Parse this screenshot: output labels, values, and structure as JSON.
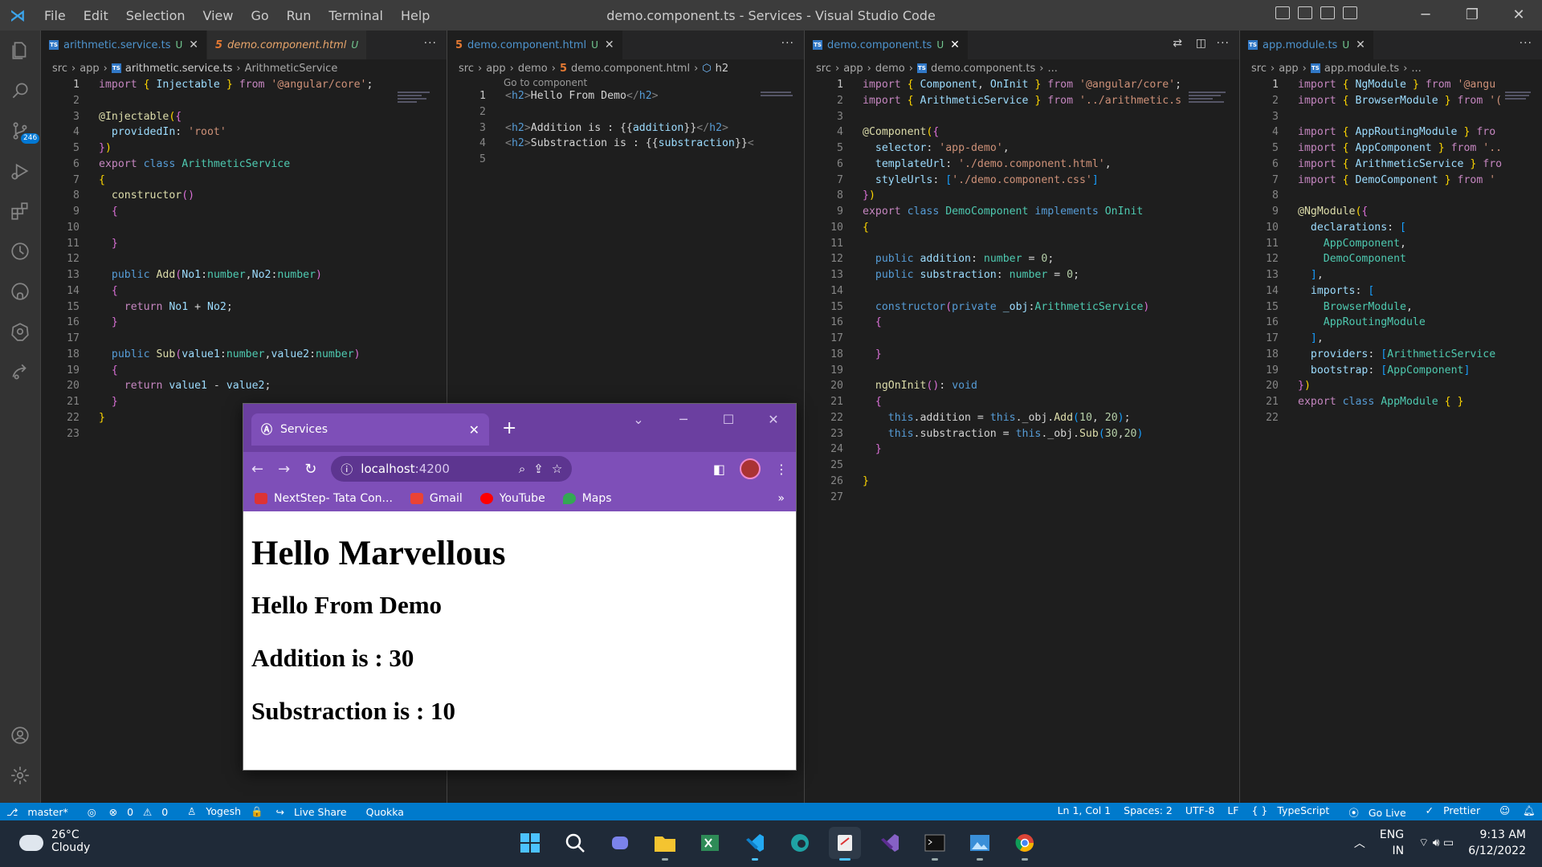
{
  "window": {
    "title": "demo.component.ts - Services - Visual Studio Code",
    "menu": [
      "File",
      "Edit",
      "Selection",
      "View",
      "Go",
      "Run",
      "Terminal",
      "Help"
    ]
  },
  "activity": {
    "scm_badge": "246"
  },
  "pane1": {
    "tab1": "arithmetic.service.ts",
    "tab2": "demo.component.html",
    "badge": "U",
    "crumb": [
      "src",
      "app",
      "arithmetic.service.ts",
      "ArithmeticService"
    ],
    "lines": [
      [
        [
          "kw2",
          "import "
        ],
        [
          "br1",
          "{ "
        ],
        [
          "var",
          "Injectable "
        ],
        [
          "br1",
          "} "
        ],
        [
          "kw2",
          "from "
        ],
        [
          "str",
          "'@angular/core'"
        ],
        [
          "",
          "; "
        ]
      ],
      [],
      [
        [
          "fn",
          "@Injectable"
        ],
        [
          "br1",
          "("
        ],
        [
          "br2",
          "{"
        ]
      ],
      [
        [
          "var",
          "  providedIn"
        ],
        [
          "",
          ": "
        ],
        [
          "str",
          "'root'"
        ]
      ],
      [
        [
          "br2",
          "}"
        ],
        [
          "br1",
          ")"
        ]
      ],
      [
        [
          "kw2",
          "export "
        ],
        [
          "kw",
          "class "
        ],
        [
          "cls",
          "ArithmeticService"
        ]
      ],
      [
        [
          "br1",
          "{"
        ]
      ],
      [
        [
          "fn",
          "  constructor"
        ],
        [
          "br2",
          "()"
        ]
      ],
      [
        [
          "br2",
          "  {"
        ]
      ],
      [],
      [
        [
          "br2",
          "  }"
        ]
      ],
      [],
      [
        [
          "kw",
          "  public "
        ],
        [
          "fn",
          "Add"
        ],
        [
          "br2",
          "("
        ],
        [
          "var",
          "No1"
        ],
        [
          "",
          ":"
        ],
        [
          "cls",
          "number"
        ],
        [
          "",
          ","
        ],
        [
          "var",
          "No2"
        ],
        [
          "",
          ":"
        ],
        [
          "cls",
          "number"
        ],
        [
          "br2",
          ")"
        ]
      ],
      [
        [
          "br2",
          "  {"
        ]
      ],
      [
        [
          "kw2",
          "    return "
        ],
        [
          "var",
          "No1"
        ],
        [
          "",
          " + "
        ],
        [
          "var",
          "No2"
        ],
        [
          "",
          ";"
        ]
      ],
      [
        [
          "br2",
          "  }"
        ]
      ],
      [],
      [
        [
          "kw",
          "  public "
        ],
        [
          "fn",
          "Sub"
        ],
        [
          "br2",
          "("
        ],
        [
          "var",
          "value1"
        ],
        [
          "",
          ":"
        ],
        [
          "cls",
          "number"
        ],
        [
          "",
          ","
        ],
        [
          "var",
          "value2"
        ],
        [
          "",
          ":"
        ],
        [
          "cls",
          "number"
        ],
        [
          "br2",
          ")"
        ]
      ],
      [
        [
          "br2",
          "  {"
        ]
      ],
      [
        [
          "kw2",
          "    return "
        ],
        [
          "var",
          "value1"
        ],
        [
          "",
          " - "
        ],
        [
          "var",
          "value2"
        ],
        [
          "",
          ";"
        ]
      ],
      [
        [
          "br2",
          "  }"
        ]
      ],
      [
        [
          "br1",
          "}"
        ]
      ],
      []
    ]
  },
  "pane2": {
    "tab": "demo.component.html",
    "badge": "U",
    "crumb": [
      "src",
      "app",
      "demo",
      "demo.component.html",
      "h2"
    ],
    "hint": "Go to component",
    "lines": [
      [
        [
          "gr",
          "<"
        ],
        [
          "tg",
          "h2"
        ],
        [
          "gr",
          ">"
        ],
        [
          "",
          "Hello From Demo"
        ],
        [
          "gr",
          "</"
        ],
        [
          "tg",
          "h2"
        ],
        [
          "gr",
          ">"
        ]
      ],
      [],
      [
        [
          "gr",
          "<"
        ],
        [
          "tg",
          "h2"
        ],
        [
          "gr",
          ">"
        ],
        [
          "",
          "Addition is : {{"
        ],
        [
          "var",
          "addition"
        ],
        [
          "",
          "}}"
        ],
        [
          "gr",
          "</"
        ],
        [
          "tg",
          "h2"
        ],
        [
          "gr",
          ">"
        ]
      ],
      [
        [
          "gr",
          "<"
        ],
        [
          "tg",
          "h2"
        ],
        [
          "gr",
          ">"
        ],
        [
          "",
          "Substraction is : {{"
        ],
        [
          "var",
          "substraction"
        ],
        [
          "",
          "}}"
        ],
        [
          "gr",
          "<"
        ]
      ],
      []
    ]
  },
  "pane3": {
    "tab": "demo.component.ts",
    "badge": "U",
    "crumb": [
      "src",
      "app",
      "demo",
      "demo.component.ts",
      "..."
    ],
    "lines": [
      [
        [
          "kw2",
          "import "
        ],
        [
          "br1",
          "{ "
        ],
        [
          "var",
          "Component"
        ],
        [
          "",
          ", "
        ],
        [
          "var",
          "OnInit "
        ],
        [
          "br1",
          "} "
        ],
        [
          "kw2",
          "from "
        ],
        [
          "str",
          "'@angular/core'"
        ],
        [
          "",
          ";"
        ]
      ],
      [
        [
          "kw2",
          "import "
        ],
        [
          "br1",
          "{ "
        ],
        [
          "var",
          "ArithmeticService "
        ],
        [
          "br1",
          "} "
        ],
        [
          "kw2",
          "from "
        ],
        [
          "str",
          "'../arithmetic.s"
        ]
      ],
      [],
      [
        [
          "fn",
          "@Component"
        ],
        [
          "br1",
          "("
        ],
        [
          "br2",
          "{"
        ]
      ],
      [
        [
          "var",
          "  selector"
        ],
        [
          "",
          ": "
        ],
        [
          "str",
          "'app-demo'"
        ],
        [
          "",
          ","
        ]
      ],
      [
        [
          "var",
          "  templateUrl"
        ],
        [
          "",
          ": "
        ],
        [
          "str",
          "'./demo.component.html'"
        ],
        [
          "",
          ","
        ]
      ],
      [
        [
          "var",
          "  styleUrls"
        ],
        [
          "",
          ": "
        ],
        [
          "br3",
          "["
        ],
        [
          "str",
          "'./demo.component.css'"
        ],
        [
          "br3",
          "]"
        ]
      ],
      [
        [
          "br2",
          "}"
        ],
        [
          "br1",
          ")"
        ]
      ],
      [
        [
          "kw2",
          "export "
        ],
        [
          "kw",
          "class "
        ],
        [
          "cls",
          "DemoComponent "
        ],
        [
          "kw",
          "implements "
        ],
        [
          "cls",
          "OnInit"
        ]
      ],
      [
        [
          "br1",
          "{"
        ]
      ],
      [],
      [
        [
          "kw",
          "  public "
        ],
        [
          "var",
          "addition"
        ],
        [
          "",
          ": "
        ],
        [
          "cls",
          "number"
        ],
        [
          "",
          " = "
        ],
        [
          "num",
          "0"
        ],
        [
          "",
          ";"
        ]
      ],
      [
        [
          "kw",
          "  public "
        ],
        [
          "var",
          "substraction"
        ],
        [
          "",
          ": "
        ],
        [
          "cls",
          "number"
        ],
        [
          "",
          " = "
        ],
        [
          "num",
          "0"
        ],
        [
          "",
          ";"
        ]
      ],
      [],
      [
        [
          "kw",
          "  constructor"
        ],
        [
          "br2",
          "("
        ],
        [
          "kw",
          "private "
        ],
        [
          "var",
          "_obj"
        ],
        [
          "",
          ":"
        ],
        [
          "cls",
          "ArithmeticService"
        ],
        [
          "br2",
          ")"
        ]
      ],
      [
        [
          "br2",
          "  {"
        ]
      ],
      [],
      [
        [
          "br2",
          "  }"
        ]
      ],
      [],
      [
        [
          "fn",
          "  ngOnInit"
        ],
        [
          "br2",
          "()"
        ],
        [
          "",
          ": "
        ],
        [
          "kw",
          "void"
        ]
      ],
      [
        [
          "br2",
          "  {"
        ]
      ],
      [
        [
          "kw",
          "    this"
        ],
        [
          "",
          ".addition = "
        ],
        [
          "kw",
          "this"
        ],
        [
          "",
          "._obj."
        ],
        [
          "fn",
          "Add"
        ],
        [
          "br3",
          "("
        ],
        [
          "num",
          "10"
        ],
        [
          "",
          ", "
        ],
        [
          "num",
          "20"
        ],
        [
          "br3",
          ")"
        ],
        [
          "",
          ";"
        ]
      ],
      [
        [
          "kw",
          "    this"
        ],
        [
          "",
          ".substraction = "
        ],
        [
          "kw",
          "this"
        ],
        [
          "",
          "._obj."
        ],
        [
          "fn",
          "Sub"
        ],
        [
          "br3",
          "("
        ],
        [
          "num",
          "30"
        ],
        [
          "",
          ","
        ],
        [
          "num",
          "20"
        ],
        [
          "br3",
          ")"
        ]
      ],
      [
        [
          "br2",
          "  }"
        ]
      ],
      [],
      [
        [
          "br1",
          "}"
        ]
      ],
      []
    ]
  },
  "pane4": {
    "tab": "app.module.ts",
    "badge": "U",
    "crumb": [
      "src",
      "app",
      "app.module.ts",
      "..."
    ],
    "lines": [
      [
        [
          "kw2",
          "import "
        ],
        [
          "br1",
          "{ "
        ],
        [
          "var",
          "NgModule "
        ],
        [
          "br1",
          "} "
        ],
        [
          "kw2",
          "from "
        ],
        [
          "str",
          "'@angu"
        ]
      ],
      [
        [
          "kw2",
          "import "
        ],
        [
          "br1",
          "{ "
        ],
        [
          "var",
          "BrowserModule "
        ],
        [
          "br1",
          "} "
        ],
        [
          "kw2",
          "from "
        ],
        [
          "str",
          "'("
        ]
      ],
      [],
      [
        [
          "kw2",
          "import "
        ],
        [
          "br1",
          "{ "
        ],
        [
          "var",
          "AppRoutingModule "
        ],
        [
          "br1",
          "} "
        ],
        [
          "kw2",
          "fro"
        ]
      ],
      [
        [
          "kw2",
          "import "
        ],
        [
          "br1",
          "{ "
        ],
        [
          "var",
          "AppComponent "
        ],
        [
          "br1",
          "} "
        ],
        [
          "kw2",
          "from "
        ],
        [
          "str",
          "'.."
        ]
      ],
      [
        [
          "kw2",
          "import "
        ],
        [
          "br1",
          "{ "
        ],
        [
          "var",
          "ArithmeticService "
        ],
        [
          "br1",
          "} "
        ],
        [
          "kw2",
          "fro"
        ]
      ],
      [
        [
          "kw2",
          "import "
        ],
        [
          "br1",
          "{ "
        ],
        [
          "var",
          "DemoComponent "
        ],
        [
          "br1",
          "} "
        ],
        [
          "kw2",
          "from "
        ],
        [
          "str",
          "'"
        ]
      ],
      [],
      [
        [
          "fn",
          "@NgModule"
        ],
        [
          "br1",
          "("
        ],
        [
          "br2",
          "{"
        ]
      ],
      [
        [
          "var",
          "  declarations"
        ],
        [
          "",
          ": "
        ],
        [
          "br3",
          "["
        ]
      ],
      [
        [
          "cls",
          "    AppComponent"
        ],
        [
          "",
          ","
        ]
      ],
      [
        [
          "cls",
          "    DemoComponent"
        ]
      ],
      [
        [
          "br3",
          "  ]"
        ],
        [
          "",
          ","
        ]
      ],
      [
        [
          "var",
          "  imports"
        ],
        [
          "",
          ": "
        ],
        [
          "br3",
          "["
        ]
      ],
      [
        [
          "cls",
          "    BrowserModule"
        ],
        [
          "",
          ","
        ]
      ],
      [
        [
          "cls",
          "    AppRoutingModule"
        ]
      ],
      [
        [
          "br3",
          "  ]"
        ],
        [
          "",
          ","
        ]
      ],
      [
        [
          "var",
          "  providers"
        ],
        [
          "",
          ": "
        ],
        [
          "br3",
          "["
        ],
        [
          "cls",
          "ArithmeticService"
        ]
      ],
      [
        [
          "var",
          "  bootstrap"
        ],
        [
          "",
          ": "
        ],
        [
          "br3",
          "["
        ],
        [
          "cls",
          "AppComponent"
        ],
        [
          "br3",
          "]"
        ]
      ],
      [
        [
          "br2",
          "}"
        ],
        [
          "br1",
          ")"
        ]
      ],
      [
        [
          "kw2",
          "export "
        ],
        [
          "kw",
          "class "
        ],
        [
          "cls",
          "AppModule "
        ],
        [
          "br1",
          "{ }"
        ]
      ],
      []
    ]
  },
  "browser": {
    "tab_title": "Services",
    "url_host": "localhost",
    "url_port": ":4200",
    "bookmarks": [
      "NextStep- Tata Con...",
      "Gmail",
      "YouTube",
      "Maps"
    ],
    "h1": "Hello Marvellous",
    "h2a": "Hello From Demo",
    "h2b": "Addition is : 30",
    "h2c": "Substraction is : 10"
  },
  "status": {
    "branch": "master*",
    "errors": "0",
    "warnings": "0",
    "user": "Yogesh",
    "liveshare": "Live Share",
    "quokka": "Quokka",
    "cursor": "Ln 1, Col 1",
    "spaces": "Spaces: 2",
    "encoding": "UTF-8",
    "eol": "LF",
    "lang": "TypeScript",
    "golive": "Go Live",
    "prettier": "Prettier"
  },
  "taskbar": {
    "temp": "26°C",
    "weather": "Cloudy",
    "lang1": "ENG",
    "lang2": "IN",
    "time": "9:13 AM",
    "date": "6/12/2022"
  }
}
